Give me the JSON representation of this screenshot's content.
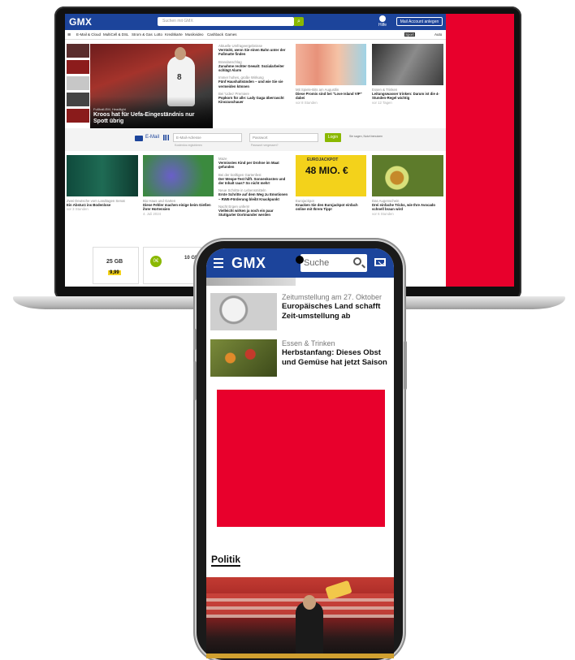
{
  "laptop": {
    "header": {
      "logo": "GMX",
      "search_placeholder": "Suchen mit GMX",
      "help_label": "Hilfe",
      "create_account_label": "Mail Account anlegen"
    },
    "nav": [
      "E-Mail & Cloud",
      "MultiCell & DSL",
      "Strom & Gas",
      "Lotto",
      "Kreditkarte",
      "Musikvideo",
      "Cashback",
      "Games"
    ],
    "nav_right": [
      "Sport",
      "Auto"
    ],
    "hero": {
      "kicker": "Fußball-EM, Headlight",
      "title": "Kroos hat für Uefa-Eingeständnis nur Spott übrig"
    },
    "mid_news": [
      {
        "kicker": "Aktuelle Umfrageergebnisse",
        "title": "Verrückt, wenn Sie einen Bahn unter der Fußmatte finden"
      },
      {
        "kicker": "Brandanschlag",
        "title": "Zunahme rechter Gewalt: Sozialarbeiter schlägt Alarm"
      },
      {
        "kicker": "Immer hohes, große Wirkung",
        "title": "Fünf Haushaltsünden – und wie Sie sie vermeiden können"
      },
      {
        "kicker": "Bei 'Udeo' Premiere",
        "title": "Popkorn für alle: Lady Gaga überrascht Kinozuschauer"
      }
    ],
    "card_love_island": {
      "kicker": "Mit Spiele-Bits am Augustlin",
      "title": "Diese Promis sind bei \"Love Island VIP\" dabei",
      "date": "vor 8 Stunden"
    },
    "card_water": {
      "kicker": "Essen & Trinken",
      "title": "Leitungswasser trinken: Darum ist die 4-Stunden-Regel wichtig",
      "date": "vor 12 Tagen"
    },
    "login": {
      "email_label": "E-Mail",
      "email_placeholder": "E-Mail-Adresse",
      "password_placeholder": "Passwort",
      "email_hint": "Kostenlos registrieren",
      "password_hint": "Passwort vergessen?",
      "login_button": "Login",
      "secure_label": "Sie sagen, Nutzt benutzen"
    },
    "card_crash": {
      "kicker": "Zwei Deutsche vom Landtagen Senat",
      "title": "Ein Absturz ins Bodenlose",
      "date": "vor 3 Stunden"
    },
    "card_hydrangea": {
      "kicker": "Bio Haus und Garten",
      "title": "Diese Fehler machen einige beim Gießen ihrer Hortensien",
      "date": "4. Juli 2024"
    },
    "mid_news_2": [
      {
        "kicker": "Maze",
        "title": "Vermisstes Kind per Drohne im Maat gefunden"
      },
      {
        "kicker": "Bei der kraftigen Gartenfest",
        "title": "Der Wespe-Test hilft. Sonnenkosten und der Inhalt raus? So nicht mehr!"
      },
      {
        "kicker": "Neue Schritte in Lebensmitteln",
        "title": "Erste Schritte auf dem Weg zu Emotionen – RWE-Förderung bleibt Knackpunkt"
      },
      {
        "kicker": "Nacht Ergen unfern!",
        "title": "Vielleicht wirken ja noch ein paar Stuttgarter Dortmunder werden"
      }
    ],
    "card_eurojackpot": {
      "amount": "48 MIO. €",
      "brand": "EUROJACKPOT",
      "kicker": "Eurojackpot",
      "title": "Knacken Sie den Eurojackpot einfach online mit Ihrem Tipp!"
    },
    "card_avocado": {
      "kicker": "Das Augenschein",
      "title": "Drei einfache Tricks, wie Ihre Avocado schnell braun wird",
      "date": "vor 6 Stunden"
    },
    "bottom_ads": {
      "data_label": "25 GB",
      "data_price": "9,99",
      "zero_label": "0€",
      "small_label": "10 GB"
    }
  },
  "phone": {
    "logo": "GMX",
    "search_placeholder": "Suche",
    "articles": [
      {
        "kicker": "Zeitumstellung am 27. Oktober",
        "title": "Europäisches Land schafft Zeit-umstellung ab"
      },
      {
        "kicker": "Essen & Trinken",
        "title": "Herbstanfang: Dieses Obst und Gemüse hat jetzt Saison"
      }
    ],
    "section_title": "Politik"
  },
  "colors": {
    "brand_blue": "#1c449b",
    "accent_green": "#8ab800",
    "ad_red": "#e8002c"
  }
}
